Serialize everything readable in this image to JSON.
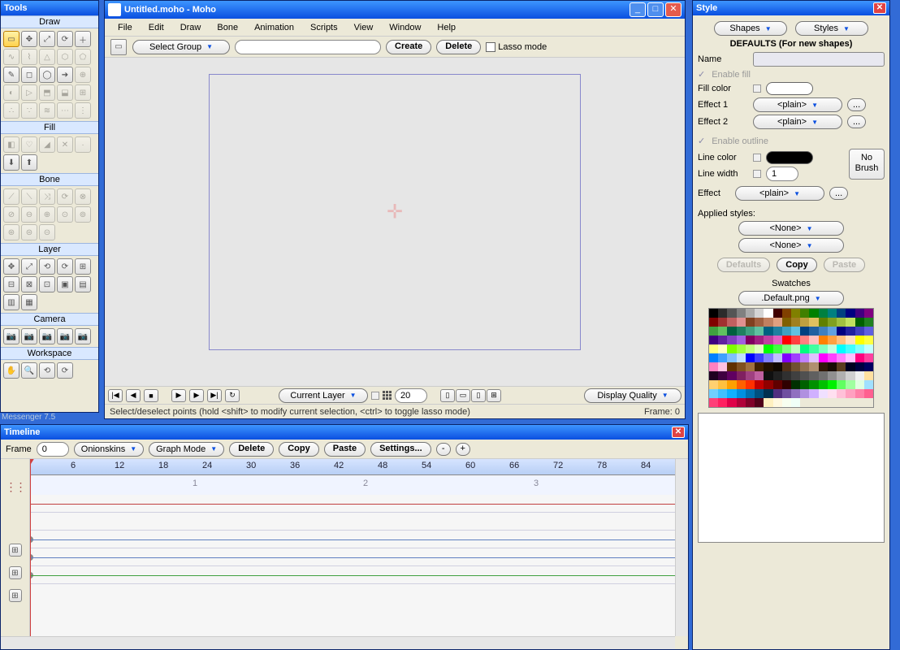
{
  "tools_panel": {
    "title": "Tools",
    "sections": {
      "draw": "Draw",
      "fill": "Fill",
      "bone": "Bone",
      "layer": "Layer",
      "camera": "Camera",
      "workspace": "Workspace"
    }
  },
  "main_window": {
    "title": "Untitled.moho - Moho",
    "menubar": [
      "File",
      "Edit",
      "Draw",
      "Bone",
      "Animation",
      "Scripts",
      "View",
      "Window",
      "Help"
    ],
    "toolbar": {
      "select_group": "Select Group",
      "create": "Create",
      "delete": "Delete",
      "lasso_mode": "Lasso mode"
    },
    "bottombar": {
      "layer_scope": "Current Layer",
      "frame_value": "20",
      "display_quality": "Display Quality"
    },
    "status": {
      "hint": "Select/deselect points (hold <shift> to modify current selection, <ctrl> to toggle lasso mode)",
      "frame_label": "Frame: 0"
    }
  },
  "style_panel": {
    "title": "Style",
    "shapes_btn": "Shapes",
    "styles_btn": "Styles",
    "defaults_header": "DEFAULTS (For new shapes)",
    "name_label": "Name",
    "enable_fill": "Enable fill",
    "fill_color": "Fill color",
    "effect1": "Effect 1",
    "effect2": "Effect 2",
    "plain": "<plain>",
    "enable_outline": "Enable outline",
    "line_color": "Line color",
    "line_width": "Line width",
    "line_width_value": "1",
    "effect": "Effect",
    "no_brush": "No Brush",
    "applied_styles": "Applied styles:",
    "none": "<None>",
    "defaults_btn": "Defaults",
    "copy_btn": "Copy",
    "paste_btn": "Paste",
    "swatches": "Swatches",
    "swatch_file": ".Default.png",
    "ellipsis": "..."
  },
  "timeline": {
    "title": "Timeline",
    "frame_label": "Frame",
    "frame_value": "0",
    "onionskins": "Onionskins",
    "graph_mode": "Graph Mode",
    "delete": "Delete",
    "copy": "Copy",
    "paste": "Paste",
    "settings": "Settings...",
    "minus": "-",
    "plus": "+",
    "ruler_marks": [
      "6",
      "12",
      "18",
      "24",
      "30",
      "36",
      "42",
      "48",
      "54",
      "60",
      "66",
      "72",
      "78",
      "84"
    ],
    "sub_marks": [
      "1",
      "2",
      "3"
    ]
  },
  "messenger_text": "Messenger 7.5",
  "swatch_colors": [
    "#000000",
    "#2b2b2b",
    "#555555",
    "#808080",
    "#aaaaaa",
    "#d4d4d4",
    "#ffffff",
    "#400000",
    "#804000",
    "#808000",
    "#408000",
    "#008000",
    "#008040",
    "#008080",
    "#004080",
    "#000080",
    "#400080",
    "#800080",
    "#800000",
    "#a03030",
    "#c06060",
    "#e09090",
    "#804020",
    "#a06040",
    "#c08060",
    "#e0a080",
    "#806000",
    "#a08020",
    "#c0a040",
    "#e0c060",
    "#608000",
    "#80a020",
    "#a0c040",
    "#c0e060",
    "#006000",
    "#208020",
    "#40a040",
    "#60c060",
    "#006040",
    "#208060",
    "#40a080",
    "#60c0a0",
    "#006080",
    "#2080a0",
    "#40a0c0",
    "#60c0e0",
    "#004080",
    "#2060a0",
    "#4080c0",
    "#60a0e0",
    "#000080",
    "#2020a0",
    "#4040c0",
    "#6060e0",
    "#400080",
    "#6020a0",
    "#8040c0",
    "#a060e0",
    "#800060",
    "#a02080",
    "#c040a0",
    "#e060c0",
    "#ff0000",
    "#ff4040",
    "#ff8080",
    "#ffc0c0",
    "#ff8000",
    "#ffa040",
    "#ffc080",
    "#ffe0c0",
    "#ffff00",
    "#ffff40",
    "#ffff80",
    "#ffffc0",
    "#80ff00",
    "#a0ff40",
    "#c0ff80",
    "#e0ffc0",
    "#00ff00",
    "#40ff40",
    "#80ff80",
    "#c0ffc0",
    "#00ff80",
    "#40ffa0",
    "#80ffc0",
    "#c0ffe0",
    "#00ffff",
    "#40ffff",
    "#80ffff",
    "#c0ffff",
    "#0080ff",
    "#40a0ff",
    "#80c0ff",
    "#c0e0ff",
    "#0000ff",
    "#4040ff",
    "#8080ff",
    "#c0c0ff",
    "#8000ff",
    "#a040ff",
    "#c080ff",
    "#e0c0ff",
    "#ff00ff",
    "#ff40ff",
    "#ff80ff",
    "#ffc0ff",
    "#ff0080",
    "#ff40a0",
    "#ff80c0",
    "#ffc0e0",
    "#603000",
    "#805020",
    "#a07040",
    "#402000",
    "#201000",
    "#100800",
    "#503018",
    "#705030",
    "#907050",
    "#b09070",
    "#301808",
    "#180c04",
    "#5a3c1e",
    "#000020",
    "#000040",
    "#000060",
    "#200020",
    "#400040",
    "#600060",
    "#802060",
    "#a04080",
    "#c060a0",
    "#101010",
    "#202020",
    "#303030",
    "#404040",
    "#505050",
    "#606060",
    "#707070",
    "#909090",
    "#b0b0b0",
    "#d0d0d0",
    "#f0f0f0",
    "#ffe0a0",
    "#ffd070",
    "#ffc040",
    "#ffa000",
    "#ff6000",
    "#ff3000",
    "#c00000",
    "#900000",
    "#600000",
    "#300000",
    "#003000",
    "#006000",
    "#009000",
    "#00c000",
    "#00f000",
    "#60ff60",
    "#a0ffa0",
    "#e0ffe0",
    "#a0e0ff",
    "#70d0ff",
    "#40c0ff",
    "#10b0ff",
    "#0090e0",
    "#0070b0",
    "#005080",
    "#003050",
    "#503080",
    "#7050a0",
    "#9070c0",
    "#b090e0",
    "#d0b0ff",
    "#f0e0ff",
    "#ffe0f0",
    "#ffc0d8",
    "#ffa0c0",
    "#ff80a8",
    "#ff6090",
    "#ff4078",
    "#ff2060",
    "#e00048",
    "#b00038",
    "#800028",
    "#500018",
    "#fff0c0",
    "#fff8e0",
    "#f8fff0",
    "#f0fff8"
  ]
}
